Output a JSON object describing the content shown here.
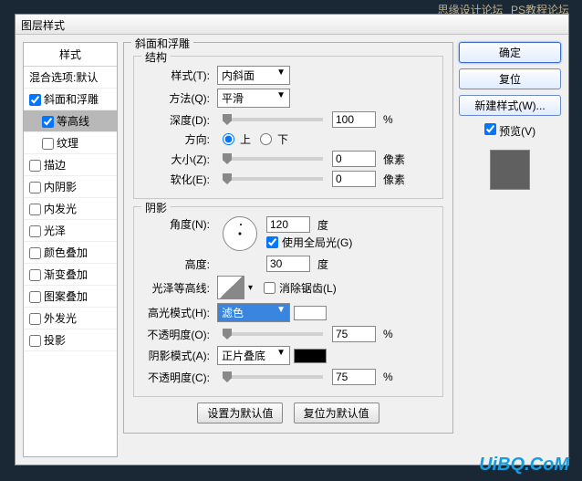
{
  "topWatermark1": "思缘设计论坛",
  "topWatermark2": "PS教程论坛",
  "title": "图层样式",
  "sidebar": {
    "header": "样式",
    "blend": "混合选项:默认",
    "items": [
      {
        "label": "斜面和浮雕",
        "checked": true,
        "selected": false
      },
      {
        "label": "等高线",
        "checked": true,
        "selected": true,
        "sub": true
      },
      {
        "label": "纹理",
        "checked": false,
        "selected": false,
        "sub": true
      },
      {
        "label": "描边",
        "checked": false
      },
      {
        "label": "内阴影",
        "checked": false
      },
      {
        "label": "内发光",
        "checked": false
      },
      {
        "label": "光泽",
        "checked": false
      },
      {
        "label": "颜色叠加",
        "checked": false
      },
      {
        "label": "渐变叠加",
        "checked": false
      },
      {
        "label": "图案叠加",
        "checked": false
      },
      {
        "label": "外发光",
        "checked": false
      },
      {
        "label": "投影",
        "checked": false
      }
    ]
  },
  "main": {
    "groupTitle": "斜面和浮雕",
    "structure": {
      "title": "结构",
      "style": {
        "label": "样式(T):",
        "value": "内斜面"
      },
      "technique": {
        "label": "方法(Q):",
        "value": "平滑"
      },
      "depth": {
        "label": "深度(D):",
        "value": "100",
        "unit": "%"
      },
      "direction": {
        "label": "方向:",
        "up": "上",
        "down": "下"
      },
      "size": {
        "label": "大小(Z):",
        "value": "0",
        "unit": "像素"
      },
      "soften": {
        "label": "软化(E):",
        "value": "0",
        "unit": "像素"
      }
    },
    "shading": {
      "title": "阴影",
      "angle": {
        "label": "角度(N):",
        "value": "120",
        "unit": "度"
      },
      "globalLight": "使用全局光(G)",
      "altitude": {
        "label": "高度:",
        "value": "30",
        "unit": "度"
      },
      "glossContour": {
        "label": "光泽等高线:",
        "antialias": "消除锯齿(L)"
      },
      "highlightMode": {
        "label": "高光模式(H):",
        "value": "滤色"
      },
      "highlightOpacity": {
        "label": "不透明度(O):",
        "value": "75",
        "unit": "%"
      },
      "shadowMode": {
        "label": "阴影模式(A):",
        "value": "正片叠底"
      },
      "shadowOpacity": {
        "label": "不透明度(C):",
        "value": "75",
        "unit": "%"
      }
    },
    "buttons": {
      "default": "设置为默认值",
      "reset": "复位为默认值"
    }
  },
  "right": {
    "ok": "确定",
    "cancel": "复位",
    "newStyle": "新建样式(W)...",
    "preview": "预览(V)"
  },
  "watermark": "UiBQ.CoM"
}
